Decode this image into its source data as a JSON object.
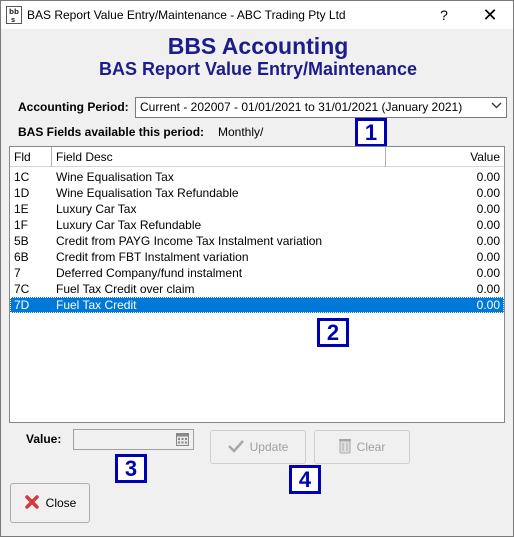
{
  "window": {
    "title": "BAS Report Value Entry/Maintenance - ABC Trading Pty Ltd",
    "help": "?",
    "close": "✕"
  },
  "header": {
    "company": "BBS Accounting",
    "subtitle": "BAS Report Value Entry/Maintenance"
  },
  "period": {
    "label": "Accounting Period:",
    "value": "Current - 202007 - 01/01/2021 to 31/01/2021 (January 2021)"
  },
  "fields_info": {
    "label": "BAS Fields available this period:",
    "value": "Monthly/"
  },
  "callouts": [
    "1",
    "2",
    "3",
    "4"
  ],
  "grid": {
    "columns": [
      "Fld",
      "Field Desc",
      "Value"
    ],
    "rows": [
      {
        "fld": "1C",
        "desc": "Wine Equalisation Tax",
        "value": "0.00"
      },
      {
        "fld": "1D",
        "desc": "Wine Equalisation Tax Refundable",
        "value": "0.00"
      },
      {
        "fld": "1E",
        "desc": "Luxury Car Tax",
        "value": "0.00"
      },
      {
        "fld": "1F",
        "desc": "Luxury Car Tax Refundable",
        "value": "0.00"
      },
      {
        "fld": "5B",
        "desc": "Credit from PAYG Income Tax Instalment variation",
        "value": "0.00"
      },
      {
        "fld": "6B",
        "desc": "Credit from FBT Instalment variation",
        "value": "0.00"
      },
      {
        "fld": "7",
        "desc": "Deferred Company/fund instalment",
        "value": "0.00"
      },
      {
        "fld": "7C",
        "desc": "Fuel Tax Credit over claim",
        "value": "0.00"
      },
      {
        "fld": "7D",
        "desc": "Fuel Tax Credit",
        "value": "0.00"
      }
    ],
    "selected_index": 8
  },
  "value_field": {
    "label": "Value:",
    "value": ""
  },
  "buttons": {
    "update": "Update",
    "clear": "Clear",
    "close": "Close"
  },
  "colors": {
    "heading": "#1c1c8c",
    "callout": "#0000b4",
    "selection": "#0078d7",
    "close_icon": "#d9363e"
  },
  "icons": {
    "app": "bbs-logo-icon",
    "update": "checkmark-icon",
    "clear": "bin-icon",
    "close": "red-x-icon",
    "calendar": "calendar-icon",
    "dropdown": "chevron-down-icon"
  }
}
